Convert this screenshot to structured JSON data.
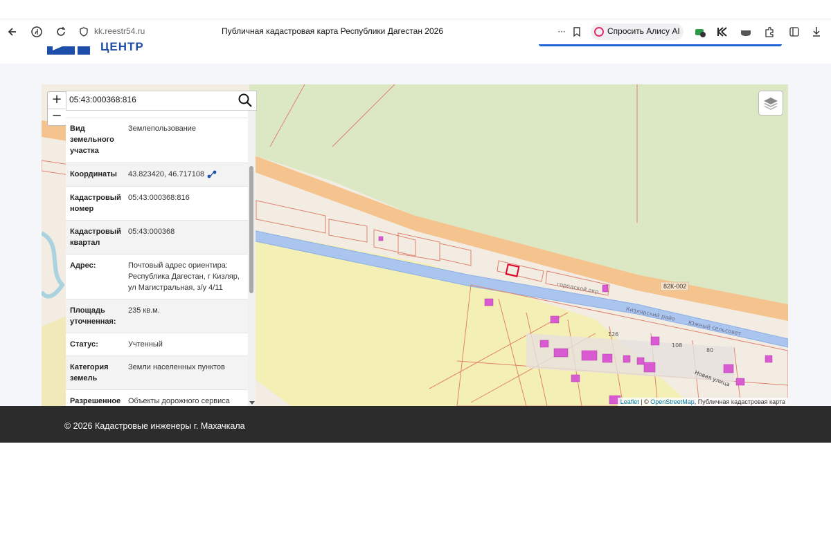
{
  "browser": {
    "url": "kk.reestr54.ru",
    "tab_title": "Публичная кадастровая карта Республики Дагестан 2026",
    "more": "···",
    "alice_label": "Спросить Алису AI",
    "icons": [
      "back-icon",
      "yandex-icon",
      "reload-icon",
      "shield-icon",
      "bookmark-icon",
      "tab-icon",
      "k-icon",
      "pocket-icon",
      "extensions-icon",
      "sidebar-icon",
      "download-icon"
    ]
  },
  "site": {
    "logo_text": "ЦЕНТР",
    "accent": "#1e63d6"
  },
  "map": {
    "zoom_in": "+",
    "zoom_out": "−",
    "search_value": "05:43:000368:816",
    "road_label": "82К-002",
    "street_labels": [
      "городской окр",
      "Кизлярский райо",
      "Южный сельсовет",
      "Новая улица",
      "126",
      "108",
      "80"
    ],
    "attribution": {
      "leaflet": "Leaflet",
      "sep": " | © ",
      "osm": "OpenStreetMap",
      "rest": ", Публичная кадастровая карта"
    }
  },
  "info": [
    {
      "key": "Вид земельного участка",
      "value": "Землепользование"
    },
    {
      "key": "Координаты",
      "value": "43.823420, 46.717108"
    },
    {
      "key": "Кадастровый номер",
      "value": "05:43:000368:816"
    },
    {
      "key": "Кадастровый квартал",
      "value": "05:43:000368"
    },
    {
      "key": "Адрес:",
      "value": "Почтовый адрес ориентира: Республика Дагестан, г Кизляр, ул Магистральная, з/у 4/11"
    },
    {
      "key": "Площадь уточненная:",
      "value": "235 кв.м."
    },
    {
      "key": "Статус:",
      "value": "Учтенный"
    },
    {
      "key": "Категория земель",
      "value": "Земли населенных пунктов"
    },
    {
      "key": "Разрешенное",
      "value": "Объекты дорожного сервиса"
    }
  ],
  "footer": {
    "text": "© 2026 Кадастровые инженеры г. Махачкала"
  }
}
